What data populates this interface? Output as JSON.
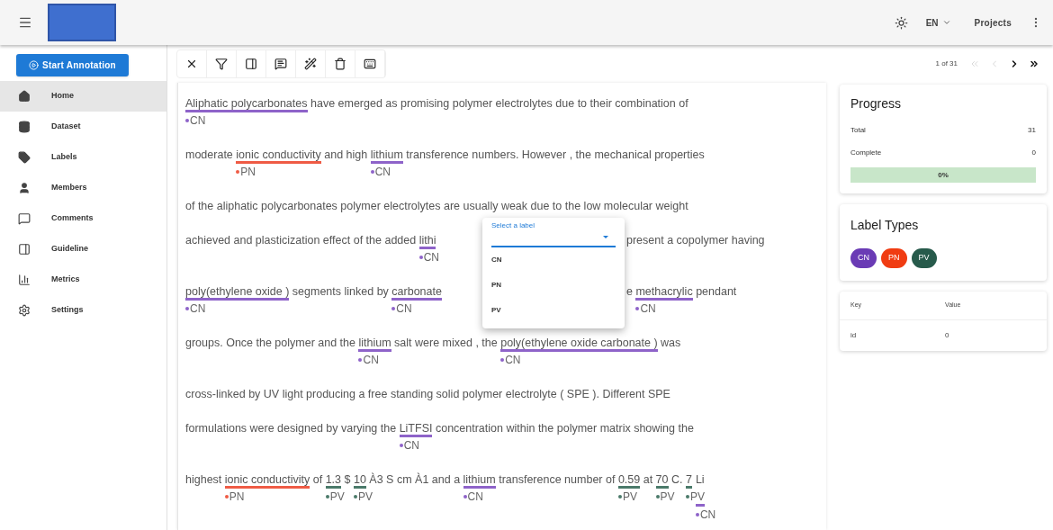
{
  "header": {
    "language": "EN",
    "projects": "Projects"
  },
  "sidebar": {
    "start_button": "Start Annotation",
    "items": [
      {
        "label": "Home",
        "selected": true
      },
      {
        "label": "Dataset",
        "selected": false
      },
      {
        "label": "Labels",
        "selected": false
      },
      {
        "label": "Members",
        "selected": false
      },
      {
        "label": "Comments",
        "selected": false
      },
      {
        "label": "Guideline",
        "selected": false
      },
      {
        "label": "Metrics",
        "selected": false
      },
      {
        "label": "Settings",
        "selected": false
      }
    ]
  },
  "pagination": {
    "text": "1 of 31",
    "buttons": [
      {
        "kind": "first",
        "disabled": true
      },
      {
        "kind": "prev",
        "disabled": true
      },
      {
        "kind": "next",
        "disabled": false
      },
      {
        "kind": "last",
        "disabled": false
      }
    ]
  },
  "document": {
    "lines": [
      {
        "segments": [
          {
            "kind": "entity",
            "text": "Aliphatic polycarbonates",
            "label": "CN",
            "color": "#8e63c9"
          },
          {
            "kind": "text",
            "text": " have emerged as promising polymer electrolytes due to their combination of"
          }
        ]
      },
      {
        "segments": [
          {
            "kind": "text",
            "text": "moderate "
          },
          {
            "kind": "entity",
            "text": "ionic conductivity",
            "label": "PN",
            "color": "#ef5b45"
          },
          {
            "kind": "text",
            "text": " and high "
          },
          {
            "kind": "entity",
            "text": "lithium",
            "label": "CN",
            "color": "#8e63c9"
          },
          {
            "kind": "text",
            "text": " transference numbers. However , the mechanical properties"
          }
        ]
      },
      {
        "segments": [
          {
            "kind": "text",
            "text": "of the aliphatic polycarbonates polymer electrolytes are usually weak due to the low molecular weight"
          }
        ]
      },
      {
        "segments": [
          {
            "kind": "text",
            "text": "achieved and plasticization effect of the added "
          },
          {
            "kind": "entity",
            "text": "lithi",
            "label": "CN",
            "color": "#8e63c9"
          },
          {
            "kind": "covered"
          },
          {
            "kind": "text",
            "text": "present a copolymer having"
          }
        ]
      },
      {
        "segments": [
          {
            "kind": "entity",
            "text": "poly(ethylene oxide )",
            "label": "CN",
            "color": "#8e63c9"
          },
          {
            "kind": "text",
            "text": " segments linked by "
          },
          {
            "kind": "entity",
            "text": "carbonate",
            "label": "CN",
            "color": "#8e63c9"
          },
          {
            "kind": "covered"
          },
          {
            "kind": "text",
            "text": "e "
          },
          {
            "kind": "entity",
            "text": "methacrylic",
            "label": "CN",
            "color": "#8e63c9"
          },
          {
            "kind": "text",
            "text": " pendant"
          }
        ]
      },
      {
        "segments": [
          {
            "kind": "text",
            "text": "groups. Once the polymer and the "
          },
          {
            "kind": "entity",
            "text": "lithium",
            "label": "CN",
            "color": "#8e63c9"
          },
          {
            "kind": "text",
            "text": " salt were mixed , the "
          },
          {
            "kind": "entity",
            "text": "poly(ethylene oxide carbonate )",
            "label": "CN",
            "color": "#8e63c9"
          },
          {
            "kind": "text",
            "text": " was"
          }
        ]
      },
      {
        "segments": [
          {
            "kind": "text",
            "text": "cross-linked by UV light producing a free standing solid polymer electrolyte ( SPE ). Different SPE"
          }
        ]
      },
      {
        "segments": [
          {
            "kind": "text",
            "text": "formulations were designed by varying the "
          },
          {
            "kind": "entity",
            "text": "LiTFSI",
            "label": "CN",
            "color": "#8e63c9"
          },
          {
            "kind": "text",
            "text": " concentration within the polymer matrix showing the"
          }
        ]
      },
      {
        "segments": [
          {
            "kind": "text",
            "text": "highest "
          },
          {
            "kind": "entity",
            "text": "ionic conductivity",
            "label": "PN",
            "color": "#ef5b45"
          },
          {
            "kind": "text",
            "text": " of "
          },
          {
            "kind": "entity",
            "text": "1.3",
            "label": "PV",
            "color": "#4b7a6a"
          },
          {
            "kind": "text",
            "text": " $ "
          },
          {
            "kind": "entity",
            "text": "10",
            "label": "PV",
            "color": "#4b7a6a"
          },
          {
            "kind": "text",
            "text": " À3 S cm À1 and a "
          },
          {
            "kind": "entity",
            "text": "lithium",
            "label": "CN",
            "color": "#8e63c9"
          },
          {
            "kind": "text",
            "text": " transference number of "
          },
          {
            "kind": "entity",
            "text": "0.59",
            "label": "PV",
            "color": "#4b7a6a"
          },
          {
            "kind": "text",
            "text": " at "
          },
          {
            "kind": "entity",
            "text": "70",
            "label": "PV",
            "color": "#4b7a6a"
          },
          {
            "kind": "text",
            "text": " C. "
          },
          {
            "kind": "entity",
            "text": "7",
            "label": "PV",
            "color": "#4b7a6a"
          },
          {
            "kind": "nested_entity",
            "text": "Li",
            "label": "CN",
            "color": "#8e63c9"
          }
        ]
      }
    ]
  },
  "label_menu": {
    "label": "Select a label",
    "options": [
      "CN",
      "PN",
      "PV"
    ]
  },
  "progress": {
    "title": "Progress",
    "rows": [
      {
        "key": "Total",
        "value": "31"
      },
      {
        "key": "Complete",
        "value": "0"
      }
    ],
    "level": 0,
    "reading": "0%"
  },
  "label_types": {
    "title": "Label Types",
    "chips": [
      {
        "text": "CN",
        "color": "#6a3bb5"
      },
      {
        "text": "PN",
        "color": "#f03c12"
      },
      {
        "text": "PV",
        "color": "#275a4b"
      }
    ]
  },
  "metadata": {
    "columns": [
      "Key",
      "Value"
    ],
    "rows": [
      [
        "id",
        "0"
      ]
    ]
  }
}
